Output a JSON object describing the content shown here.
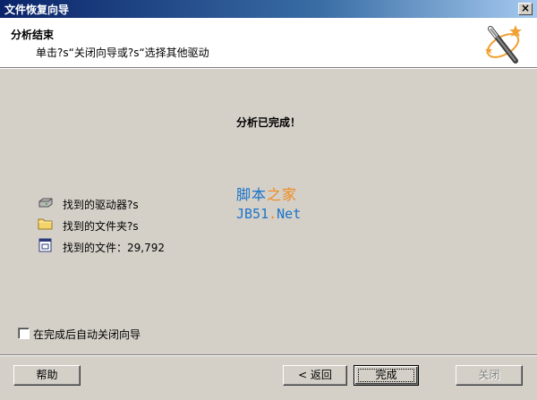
{
  "window": {
    "title": "文件恢复向导",
    "close_glyph": "×"
  },
  "header": {
    "title": "分析结束",
    "subtitle": "单击?s“关闭向导或?s“选择其他驱动"
  },
  "main": {
    "status": "分析已完成！",
    "stats": [
      {
        "icon": "drive-icon",
        "label": "找到的驱动器?s"
      },
      {
        "icon": "folder-icon",
        "label": "找到的文件夹?s"
      },
      {
        "icon": "file-icon",
        "label": "找到的文件：29,792"
      }
    ]
  },
  "watermark": {
    "line1_a": "脚本",
    "line1_b": "之家",
    "line2_a": "JB51",
    "line2_b": ".",
    "line2_c": "Net"
  },
  "options": {
    "auto_close_label": "在完成后自动关闭向导",
    "auto_close_checked": false
  },
  "buttons": {
    "help": "帮助",
    "back": "< 返回",
    "finish": "完成",
    "close": "关闭"
  },
  "colors": {
    "title_bar": "#0a246a",
    "face": "#d4d0c8",
    "watermark_blue": "#1b73c9",
    "watermark_orange": "#f08a1c"
  }
}
